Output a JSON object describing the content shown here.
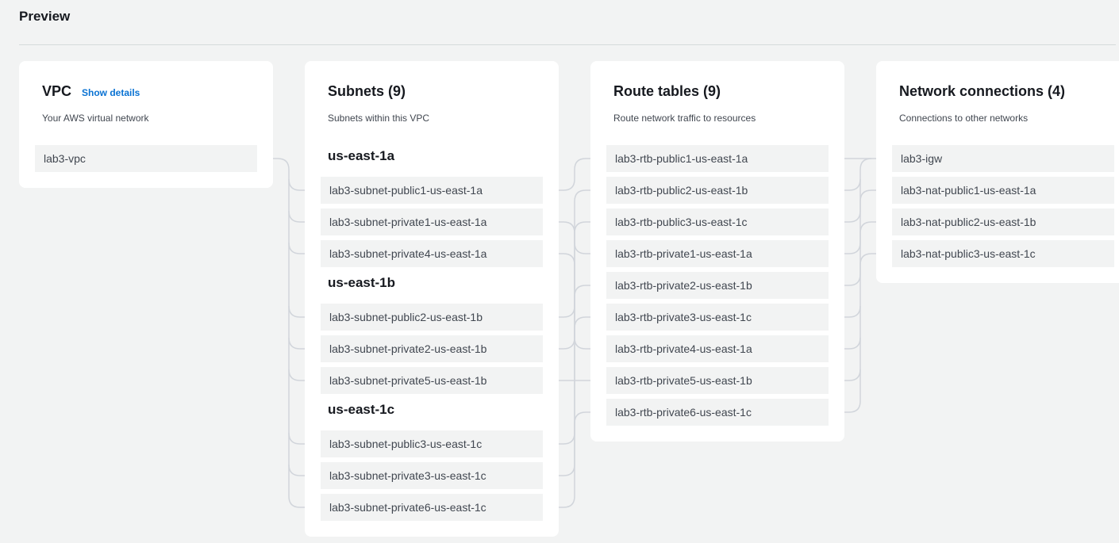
{
  "preview": {
    "title": "Preview"
  },
  "vpc": {
    "title": "VPC",
    "show_details": "Show details",
    "subtitle": "Your AWS virtual network",
    "items": [
      {
        "label": "lab3-vpc"
      }
    ]
  },
  "subnets": {
    "title": "Subnets (9)",
    "subtitle": "Subnets within this VPC",
    "groups": [
      {
        "heading": "us-east-1a",
        "items": [
          {
            "label": "lab3-subnet-public1-us-east-1a"
          },
          {
            "label": "lab3-subnet-private1-us-east-1a"
          },
          {
            "label": "lab3-subnet-private4-us-east-1a"
          }
        ]
      },
      {
        "heading": "us-east-1b",
        "items": [
          {
            "label": "lab3-subnet-public2-us-east-1b"
          },
          {
            "label": "lab3-subnet-private2-us-east-1b"
          },
          {
            "label": "lab3-subnet-private5-us-east-1b"
          }
        ]
      },
      {
        "heading": "us-east-1c",
        "items": [
          {
            "label": "lab3-subnet-public3-us-east-1c"
          },
          {
            "label": "lab3-subnet-private3-us-east-1c"
          },
          {
            "label": "lab3-subnet-private6-us-east-1c"
          }
        ]
      }
    ]
  },
  "route_tables": {
    "title": "Route tables (9)",
    "subtitle": "Route network traffic to resources",
    "items": [
      {
        "label": "lab3-rtb-public1-us-east-1a"
      },
      {
        "label": "lab3-rtb-public2-us-east-1b"
      },
      {
        "label": "lab3-rtb-public3-us-east-1c"
      },
      {
        "label": "lab3-rtb-private1-us-east-1a"
      },
      {
        "label": "lab3-rtb-private2-us-east-1b"
      },
      {
        "label": "lab3-rtb-private3-us-east-1c"
      },
      {
        "label": "lab3-rtb-private4-us-east-1a"
      },
      {
        "label": "lab3-rtb-private5-us-east-1b"
      },
      {
        "label": "lab3-rtb-private6-us-east-1c"
      }
    ]
  },
  "network_connections": {
    "title": "Network connections (4)",
    "subtitle": "Connections to other networks",
    "items": [
      {
        "label": "lab3-igw"
      },
      {
        "label": "lab3-nat-public1-us-east-1a"
      },
      {
        "label": "lab3-nat-public2-us-east-1b"
      },
      {
        "label": "lab3-nat-public3-us-east-1c"
      }
    ]
  },
  "colors": {
    "background": "#f2f3f3",
    "card": "#ffffff",
    "link": "#0972d3",
    "connector": "#d1d5db"
  }
}
